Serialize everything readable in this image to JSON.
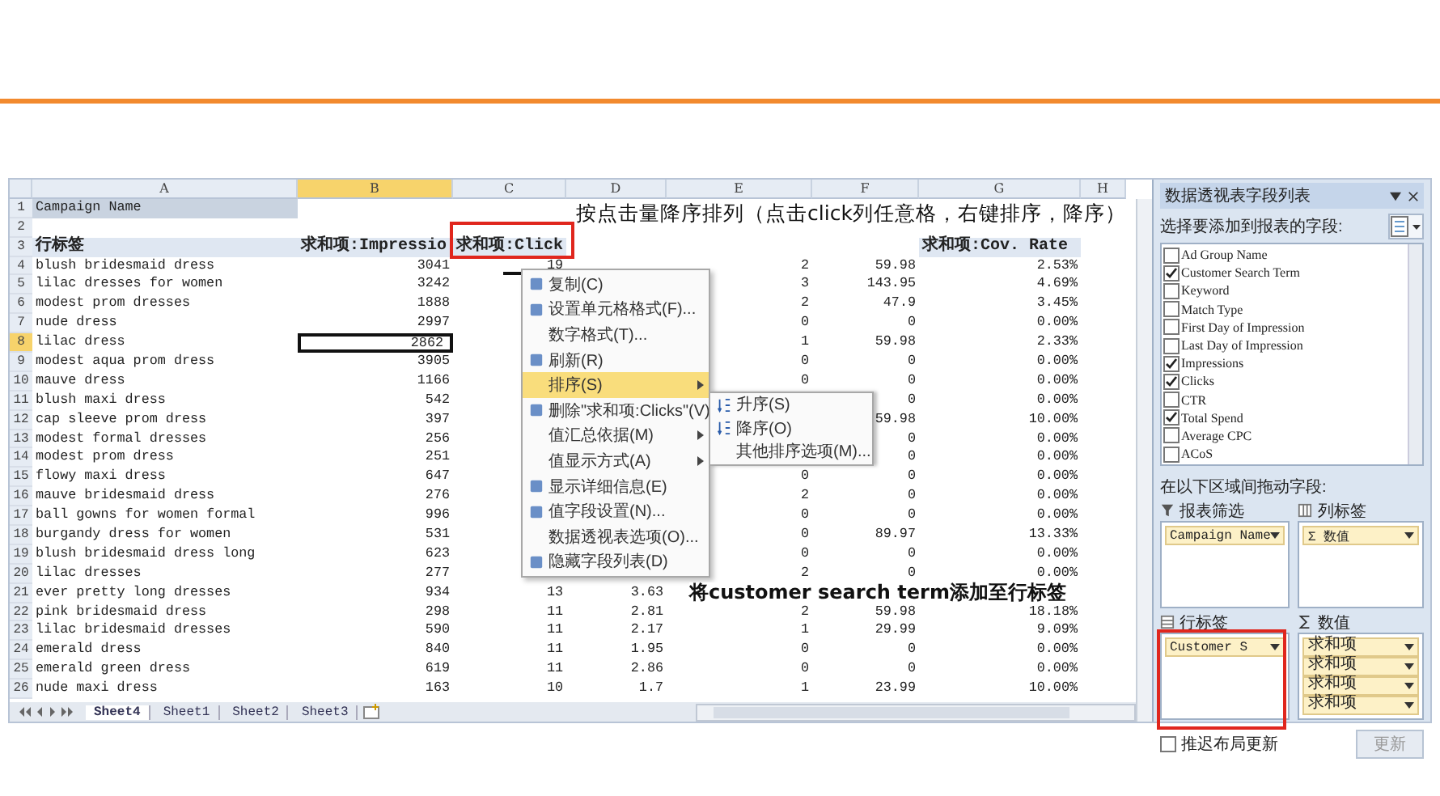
{
  "sheet": {
    "columns": [
      {
        "label": "A",
        "selected": false
      },
      {
        "label": "B",
        "selected": true
      },
      {
        "label": "C",
        "selected": false
      },
      {
        "label": "D",
        "selected": false
      },
      {
        "label": "E",
        "selected": false
      },
      {
        "label": "F",
        "selected": false
      },
      {
        "label": "G",
        "selected": false
      },
      {
        "label": "H",
        "selected": false
      }
    ],
    "rows": [
      {
        "num": "1",
        "selected": false,
        "kind": "filter",
        "cells": [
          "Campaign Name",
          null,
          null,
          null,
          null,
          null,
          null
        ]
      },
      {
        "num": "2",
        "selected": false,
        "kind": "blank",
        "cells": [
          null,
          null,
          null,
          null,
          null,
          null,
          null
        ]
      },
      {
        "num": "3",
        "selected": false,
        "kind": "header",
        "cells": [
          "行标签",
          "求和项:Impressio",
          "求和项:Click",
          null,
          null,
          null,
          "求和项:Cov. Rate"
        ]
      },
      {
        "num": "4",
        "selected": false,
        "kind": "data",
        "cells": [
          "blush bridesmaid dress",
          "3041",
          "19",
          null,
          "2",
          "59.98",
          "2.53%"
        ]
      },
      {
        "num": "5",
        "selected": false,
        "kind": "data",
        "cells": [
          "lilac dresses for women",
          "3242",
          null,
          null,
          "3",
          "143.95",
          "4.69%"
        ]
      },
      {
        "num": "6",
        "selected": false,
        "kind": "data",
        "cells": [
          "modest prom dresses",
          "1888",
          null,
          null,
          "2",
          "47.9",
          "3.45%"
        ]
      },
      {
        "num": "7",
        "selected": false,
        "kind": "data",
        "cells": [
          "nude dress",
          "2997",
          null,
          null,
          "0",
          "0",
          "0.00%"
        ]
      },
      {
        "num": "8",
        "selected": true,
        "kind": "data",
        "cells": [
          "lilac dress",
          "2862",
          null,
          null,
          "1",
          "59.98",
          "2.33%"
        ]
      },
      {
        "num": "9",
        "selected": false,
        "kind": "data",
        "cells": [
          "modest aqua prom dress",
          "3905",
          null,
          null,
          "0",
          "0",
          "0.00%"
        ]
      },
      {
        "num": "10",
        "selected": false,
        "kind": "data",
        "cells": [
          "mauve dress",
          "1166",
          null,
          null,
          "0",
          "0",
          "0.00%"
        ]
      },
      {
        "num": "11",
        "selected": false,
        "kind": "data",
        "cells": [
          "blush maxi dress",
          "542",
          null,
          null,
          null,
          "0",
          "0.00%"
        ]
      },
      {
        "num": "12",
        "selected": false,
        "kind": "data",
        "cells": [
          "cap sleeve prom dress",
          "397",
          null,
          null,
          null,
          "59.98",
          "10.00%"
        ]
      },
      {
        "num": "13",
        "selected": false,
        "kind": "data",
        "cells": [
          "modest formal dresses",
          "256",
          null,
          null,
          null,
          "0",
          "0.00%"
        ]
      },
      {
        "num": "14",
        "selected": false,
        "kind": "data",
        "cells": [
          "modest prom dress",
          "251",
          null,
          null,
          null,
          "0",
          "0.00%"
        ]
      },
      {
        "num": "15",
        "selected": false,
        "kind": "data",
        "cells": [
          "flowy maxi dress",
          "647",
          null,
          null,
          "0",
          "0",
          "0.00%"
        ]
      },
      {
        "num": "16",
        "selected": false,
        "kind": "data",
        "cells": [
          "mauve bridesmaid dress",
          "276",
          null,
          null,
          "2",
          "0",
          "0.00%"
        ]
      },
      {
        "num": "17",
        "selected": false,
        "kind": "data",
        "cells": [
          "ball gowns for women formal",
          "996",
          null,
          null,
          "0",
          "0",
          "0.00%"
        ]
      },
      {
        "num": "18",
        "selected": false,
        "kind": "data",
        "cells": [
          "burgandy dress for women",
          "531",
          null,
          null,
          "0",
          "89.97",
          "13.33%"
        ]
      },
      {
        "num": "19",
        "selected": false,
        "kind": "data",
        "cells": [
          "blush bridesmaid dress long",
          "623",
          null,
          null,
          "0",
          "0",
          "0.00%"
        ]
      },
      {
        "num": "20",
        "selected": false,
        "kind": "data",
        "cells": [
          "lilac dresses",
          "277",
          null,
          null,
          "2",
          "0",
          "0.00%"
        ]
      },
      {
        "num": "21",
        "selected": false,
        "kind": "data",
        "cells": [
          "ever pretty long dresses",
          "934",
          "13",
          "3.63",
          null,
          null,
          null
        ]
      },
      {
        "num": "22",
        "selected": false,
        "kind": "data",
        "cells": [
          "pink bridesmaid dress",
          "298",
          "11",
          "2.81",
          "2",
          "59.98",
          "18.18%"
        ]
      },
      {
        "num": "23",
        "selected": false,
        "kind": "data",
        "cells": [
          "lilac bridesmaid dresses",
          "590",
          "11",
          "2.17",
          "1",
          "29.99",
          "9.09%"
        ]
      },
      {
        "num": "24",
        "selected": false,
        "kind": "data",
        "cells": [
          "emerald dress",
          "840",
          "11",
          "1.95",
          "0",
          "0",
          "0.00%"
        ]
      },
      {
        "num": "25",
        "selected": false,
        "kind": "data",
        "cells": [
          "emerald green dress",
          "619",
          "11",
          "2.86",
          "0",
          "0",
          "0.00%"
        ]
      },
      {
        "num": "26",
        "selected": false,
        "kind": "data",
        "cells": [
          "nude maxi dress",
          "163",
          "10",
          "1.7",
          "1",
          "23.99",
          "10.00%"
        ]
      }
    ],
    "tabs": [
      {
        "label": "Sheet4",
        "selected": true
      },
      {
        "label": "Sheet1",
        "selected": false
      },
      {
        "label": "Sheet2",
        "selected": false
      },
      {
        "label": "Sheet3",
        "selected": false
      }
    ]
  },
  "context_menu": {
    "items": [
      {
        "label": "复制(C)",
        "icon": true,
        "selected": false,
        "submenu": false
      },
      {
        "label": "设置单元格格式(F)...",
        "icon": true,
        "selected": false,
        "submenu": false
      },
      {
        "label": "数字格式(T)...",
        "icon": false,
        "selected": false,
        "submenu": false
      },
      {
        "label": "刷新(R)",
        "icon": true,
        "selected": false,
        "submenu": false
      },
      {
        "label": "排序(S)",
        "icon": false,
        "selected": true,
        "submenu": true
      },
      {
        "label": "删除\"求和项:Clicks\"(V)",
        "icon": true,
        "selected": false,
        "submenu": false
      },
      {
        "label": "值汇总依据(M)",
        "icon": false,
        "selected": false,
        "submenu": true
      },
      {
        "label": "值显示方式(A)",
        "icon": false,
        "selected": false,
        "submenu": true
      },
      {
        "label": "显示详细信息(E)",
        "icon": true,
        "selected": false,
        "submenu": false
      },
      {
        "label": "值字段设置(N)...",
        "icon": true,
        "selected": false,
        "submenu": false
      },
      {
        "label": "数据透视表选项(O)...",
        "icon": false,
        "selected": false,
        "submenu": false
      },
      {
        "label": "隐藏字段列表(D)",
        "icon": true,
        "selected": false,
        "submenu": false
      }
    ],
    "submenu": [
      {
        "label": "升序(S)",
        "icon": true
      },
      {
        "label": "降序(O)",
        "icon": true
      },
      {
        "label": "其他排序选项(M)...",
        "icon": false
      }
    ]
  },
  "annotations": [
    {
      "text": "按点击量降序排列（点击click列任意格，右键排序，降序）"
    },
    {
      "text": "将customer search term添加至行标签"
    }
  ],
  "pivot_panel": {
    "title": "数据透视表字段列表",
    "choose_label": "选择要添加到报表的字段:",
    "fields": [
      {
        "label": "Ad Group Name",
        "checked": false
      },
      {
        "label": "Customer Search Term",
        "checked": true
      },
      {
        "label": "Keyword",
        "checked": false
      },
      {
        "label": "Match Type",
        "checked": false
      },
      {
        "label": "First Day of Impression",
        "checked": false
      },
      {
        "label": "Last Day of Impression",
        "checked": false
      },
      {
        "label": "Impressions",
        "checked": true
      },
      {
        "label": "Clicks",
        "checked": true
      },
      {
        "label": "CTR",
        "checked": false
      },
      {
        "label": "Total Spend",
        "checked": true
      },
      {
        "label": "Average CPC",
        "checked": false
      },
      {
        "label": "ACoS",
        "checked": false
      }
    ],
    "drag_label": "在以下区域间拖动字段:",
    "areas": [
      {
        "title": "报表筛选",
        "items": [
          "Campaign Name"
        ]
      },
      {
        "title": "列标签",
        "items": [
          "Σ 数值"
        ]
      },
      {
        "title": "行标签",
        "items": [
          "Customer S"
        ]
      },
      {
        "title": "数值",
        "items": [
          "求和项",
          "求和项",
          "求和项",
          "求和项"
        ]
      }
    ],
    "defer_label": "推迟布局更新",
    "defer_checked": false,
    "update_button": "更新"
  }
}
